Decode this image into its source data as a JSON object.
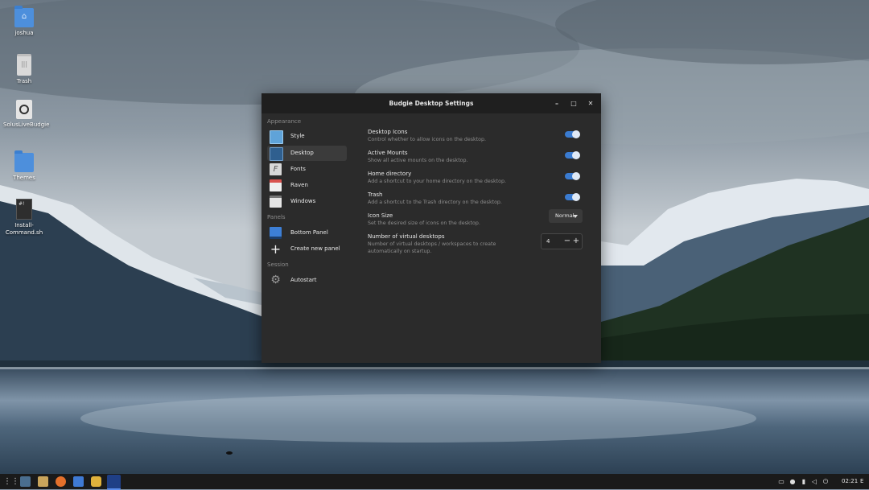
{
  "desktop": {
    "icons": [
      {
        "label": "joshua",
        "icon": "home-folder-icon"
      },
      {
        "label": "Trash",
        "icon": "trash-icon"
      },
      {
        "label": "SolusLiveBudgie",
        "icon": "optical-disc-icon"
      },
      {
        "label": "Themes",
        "icon": "folder-icon"
      },
      {
        "label": "Install-Command.sh",
        "icon": "shell-script-icon"
      }
    ]
  },
  "window": {
    "title": "Budgie Desktop Settings",
    "controls": {
      "minimize": "–",
      "maximize": "□",
      "close": "✕"
    }
  },
  "sidebar": {
    "sections": [
      {
        "label": "Appearance"
      },
      {
        "label": "Panels"
      },
      {
        "label": "Session"
      }
    ],
    "items": [
      {
        "label": "Style",
        "icon": "style-icon",
        "active": false
      },
      {
        "label": "Desktop",
        "icon": "desktop-icon",
        "active": true
      },
      {
        "label": "Fonts",
        "icon": "fonts-icon",
        "active": false
      },
      {
        "label": "Raven",
        "icon": "calendar-icon",
        "active": false
      },
      {
        "label": "Windows",
        "icon": "windows-icon",
        "active": false
      },
      {
        "label": "Bottom Panel",
        "icon": "panel-icon",
        "active": false
      },
      {
        "label": "Create new panel",
        "icon": "plus-icon",
        "active": false
      },
      {
        "label": "Autostart",
        "icon": "gear-icon",
        "active": false
      }
    ]
  },
  "settings": {
    "desktop_icons": {
      "title": "Desktop Icons",
      "desc": "Control whether to allow icons on the desktop.",
      "enabled": true
    },
    "active_mounts": {
      "title": "Active Mounts",
      "desc": "Show all active mounts on the desktop.",
      "enabled": true
    },
    "home_directory": {
      "title": "Home directory",
      "desc": "Add a shortcut to your home directory on the desktop.",
      "enabled": true
    },
    "trash": {
      "title": "Trash",
      "desc": "Add a shortcut to the Trash directory on the desktop.",
      "enabled": true
    },
    "icon_size": {
      "title": "Icon Size",
      "desc": "Set the desired size of icons on the desktop.",
      "value": "Normal"
    },
    "virtual_desktops": {
      "title": "Number of virtual desktops",
      "desc": "Number of virtual desktops / workspaces to create automatically on startup.",
      "value": "4",
      "minus": "−",
      "plus": "+"
    }
  },
  "taskbar": {
    "launcher_icon": "app-grid-icon",
    "apps": [
      "downloads-icon",
      "file-manager-icon",
      "firefox-icon",
      "software-center-icon",
      "rhythmbox-icon",
      "budgie-settings-icon"
    ],
    "tray": [
      "screen-icon",
      "notification-bell-icon",
      "battery-icon",
      "volume-icon",
      "power-icon"
    ],
    "clock": "02:21",
    "raven_toggle": "E"
  },
  "colors": {
    "accent": "#3a7bd0",
    "window_bg": "#2b2b2b",
    "titlebar_bg": "#1f1f1f",
    "taskbar_bg": "#1a1a1a"
  }
}
